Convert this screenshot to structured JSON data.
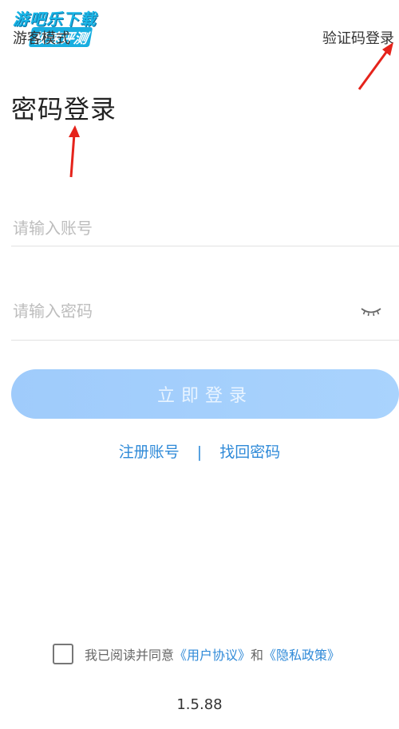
{
  "watermark": {
    "line1": "游吧乐下载",
    "line2": "极速评测"
  },
  "header": {
    "guest_mode": "游客模式",
    "sms_login": "验证码登录"
  },
  "title": "密码登录",
  "form": {
    "account_placeholder": "请输入账号",
    "password_placeholder": "请输入密码",
    "login_button": "立即登录"
  },
  "links": {
    "register": "注册账号",
    "separator": "|",
    "recover": "找回密码"
  },
  "agreement": {
    "prefix": "我已阅读并同意",
    "user_agreement": "《用户协议》",
    "and": "和",
    "privacy_policy": "《隐私政策》"
  },
  "version": "1.5.88",
  "colors": {
    "accent": "#2f8ad8",
    "button": "#a9d3fd",
    "annotation_arrow": "#e5231b"
  },
  "icons": {
    "password_toggle": "eye-closed-icon"
  }
}
